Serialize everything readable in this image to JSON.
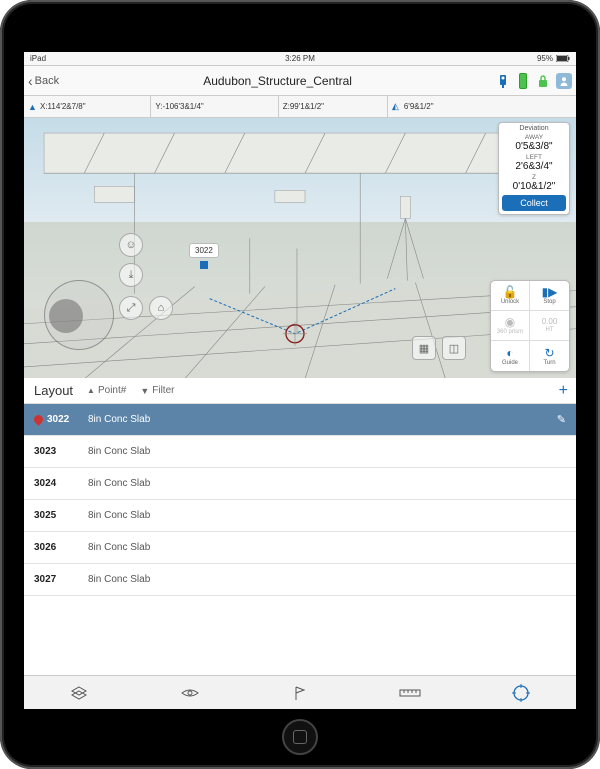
{
  "status": {
    "device": "iPad",
    "time": "3:26 PM",
    "battery": "95%"
  },
  "nav": {
    "back": "Back",
    "title": "Audubon_Structure_Central"
  },
  "coords": {
    "x": "X:114'2&7/8\"",
    "y": "Y:-106'3&1/4\"",
    "z": "Z:99'1&1/2\"",
    "dist": "6'9&1/2\""
  },
  "deviation": {
    "title": "Deviation",
    "away_label": "AWAY",
    "away": "0'5&3/8\"",
    "left_label": "LEFT",
    "left": "2'6&3/4\"",
    "z_label": "Z",
    "z": "0'10&1/2\"",
    "collect": "Collect"
  },
  "controls": {
    "unlock": "Unlock",
    "stop": "Stop",
    "prism": "360 prism",
    "ht": "HT",
    "ht_val": "0.00",
    "guide": "Guide",
    "turn": "Turn"
  },
  "callout": {
    "point": "3022"
  },
  "list": {
    "title": "Layout",
    "sort": "Point#",
    "filter": "Filter",
    "rows": [
      {
        "id": "3022",
        "desc": "8in Conc Slab"
      },
      {
        "id": "3023",
        "desc": "8in Conc Slab"
      },
      {
        "id": "3024",
        "desc": "8in Conc Slab"
      },
      {
        "id": "3025",
        "desc": "8in Conc Slab"
      },
      {
        "id": "3026",
        "desc": "8in Conc Slab"
      },
      {
        "id": "3027",
        "desc": "8in Conc Slab"
      }
    ]
  }
}
